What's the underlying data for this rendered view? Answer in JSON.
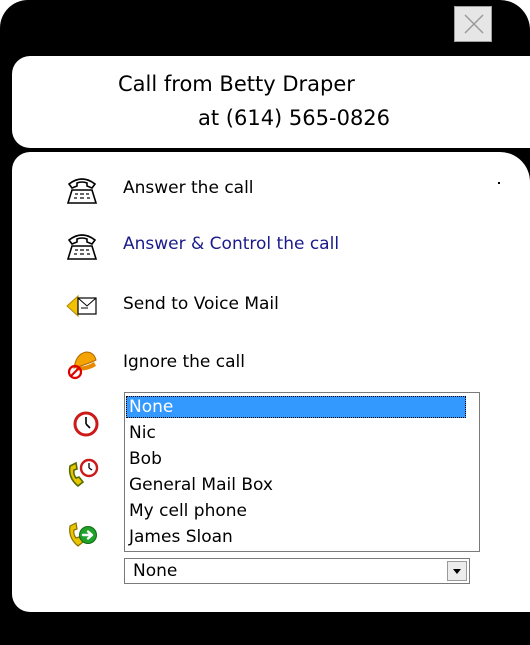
{
  "caller": {
    "line1": "Call from Betty Draper",
    "line2": "at (614) 565-0826"
  },
  "actions": [
    {
      "label": "Answer the call",
      "icon": "phone-icon"
    },
    {
      "label": "Answer & Control the call",
      "icon": "phone-icon"
    },
    {
      "label": "Send to Voice Mail",
      "icon": "voicemail-icon"
    },
    {
      "label": "Ignore the call",
      "icon": "ignore-bell-icon"
    }
  ],
  "side_icons": [
    "clock-icon",
    "phone-clock-icon",
    "forward-call-icon"
  ],
  "forward_list": {
    "items": [
      "None",
      "Nic",
      "Bob",
      "General Mail Box",
      "My cell phone",
      "James Sloan"
    ],
    "selected": "None"
  },
  "dropdown": {
    "value": "None"
  }
}
